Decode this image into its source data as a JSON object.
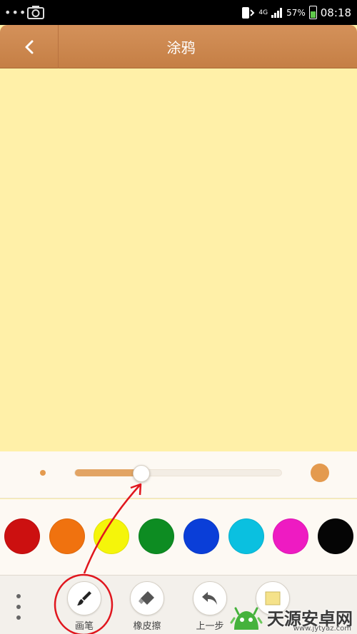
{
  "status_bar": {
    "signal_label": "4G",
    "battery": "57%",
    "time": "08:18"
  },
  "header": {
    "title": "涂鸦"
  },
  "brush_size": {
    "value_fraction": 0.32
  },
  "colors": [
    {
      "name": "red",
      "hex": "#cc1010"
    },
    {
      "name": "orange",
      "hex": "#f0720f"
    },
    {
      "name": "yellow",
      "hex": "#f5f50a"
    },
    {
      "name": "green",
      "hex": "#0d8c22"
    },
    {
      "name": "blue",
      "hex": "#0a3ed8"
    },
    {
      "name": "cyan",
      "hex": "#0ac0e0"
    },
    {
      "name": "magenta",
      "hex": "#ee1bc2"
    },
    {
      "name": "black",
      "hex": "#050505"
    }
  ],
  "toolbar": {
    "brush_label": "画笔",
    "eraser_label": "橡皮擦",
    "undo_label": "上一步"
  },
  "watermark": {
    "text": "天源安卓网",
    "url": "www.jytyaz.com"
  },
  "accent_color": "#e49a4e",
  "annotation_color": "#e0161e"
}
